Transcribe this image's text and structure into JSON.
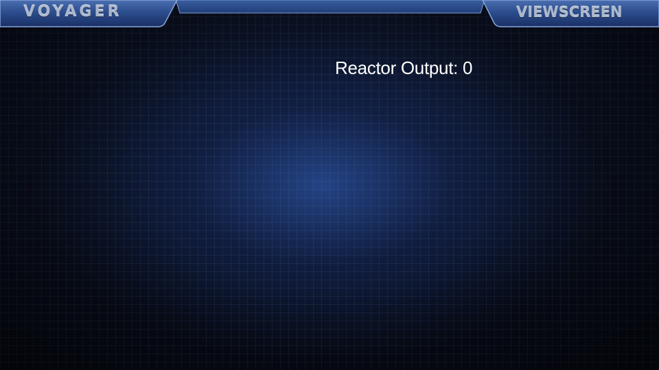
{
  "header": {
    "title": "VOYAGER",
    "view_tab_label": "VIEWSCREEN"
  },
  "readout": {
    "label": "Reactor Output:",
    "value": "0"
  },
  "theme": {
    "panel_blue": "#2d4e8f",
    "panel_edge": "#6f8fc8",
    "label_silver": "#aab7cc",
    "background": "#0b1224",
    "readout_text": "#ffffff"
  }
}
